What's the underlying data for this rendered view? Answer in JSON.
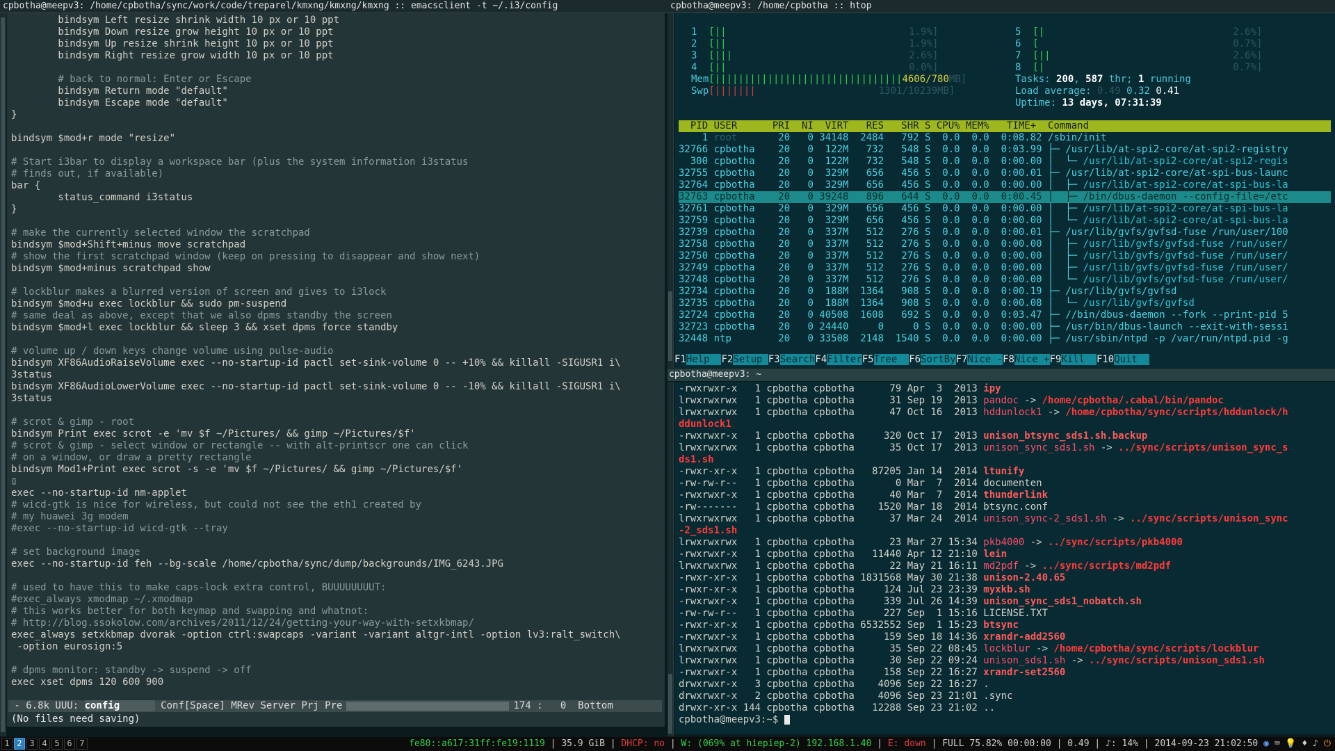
{
  "titles": {
    "emacs": "cpbotha@meepv3: /home/cpbotha/sync/work/code/treparel/kmxng/kmxng/kmxng :: emacsclient -t ~/.i3/config",
    "htop": "cpbotha@meepv3: /home/cpbotha :: htop",
    "terminal": "cpbotha@meepv3: ~"
  },
  "emacs": {
    "lines": [
      {
        "t": "        bindsym Left resize shrink width 10 px or 10 ppt",
        "c": "code"
      },
      {
        "t": "        bindsym Down resize grow height 10 px or 10 ppt",
        "c": "code"
      },
      {
        "t": "        bindsym Up resize shrink height 10 px or 10 ppt",
        "c": "code"
      },
      {
        "t": "        bindsym Right resize grow width 10 px or 10 ppt",
        "c": "code"
      },
      {
        "t": "",
        "c": "code"
      },
      {
        "t": "        # back to normal: Enter or Escape",
        "c": "comment"
      },
      {
        "t": "        bindsym Return mode \"default\"",
        "c": "code"
      },
      {
        "t": "        bindsym Escape mode \"default\"",
        "c": "code"
      },
      {
        "t": "}",
        "c": "code"
      },
      {
        "t": "",
        "c": "code"
      },
      {
        "t": "bindsym $mod+r mode \"resize\"",
        "c": "code"
      },
      {
        "t": "",
        "c": "code"
      },
      {
        "t": "# Start i3bar to display a workspace bar (plus the system information i3status",
        "c": "comment"
      },
      {
        "t": "# finds out, if available)",
        "c": "comment"
      },
      {
        "t": "bar {",
        "c": "code"
      },
      {
        "t": "        status_command i3status",
        "c": "code"
      },
      {
        "t": "}",
        "c": "code"
      },
      {
        "t": "",
        "c": "code"
      },
      {
        "t": "# make the currently selected window the scratchpad",
        "c": "comment"
      },
      {
        "t": "bindsym $mod+Shift+minus move scratchpad",
        "c": "code"
      },
      {
        "t": "# show the first scratchpad window (keep on pressing to disappear and show next)",
        "c": "comment"
      },
      {
        "t": "bindsym $mod+minus scratchpad show",
        "c": "code"
      },
      {
        "t": "",
        "c": "code"
      },
      {
        "t": "# lockblur makes a blurred version of screen and gives to i3lock",
        "c": "comment"
      },
      {
        "t": "bindsym $mod+u exec lockblur && sudo pm-suspend",
        "c": "code"
      },
      {
        "t": "# same deal as above, except that we also dpms standby the screen",
        "c": "comment"
      },
      {
        "t": "bindsym $mod+l exec lockblur && sleep 3 && xset dpms force standby",
        "c": "code"
      },
      {
        "t": "",
        "c": "code"
      },
      {
        "t": "# volume up / down keys change volume using pulse-audio",
        "c": "comment"
      },
      {
        "t": "bindsym XF86AudioRaiseVolume exec --no-startup-id pactl set-sink-volume 0 -- +10% && killall -SIGUSR1 i\\",
        "c": "code"
      },
      {
        "t": "3status",
        "c": "code"
      },
      {
        "t": "bindsym XF86AudioLowerVolume exec --no-startup-id pactl set-sink-volume 0 -- -10% && killall -SIGUSR1 i\\",
        "c": "code"
      },
      {
        "t": "3status",
        "c": "code"
      },
      {
        "t": "",
        "c": "code"
      },
      {
        "t": "# scrot & gimp - root",
        "c": "comment"
      },
      {
        "t": "bindsym Print exec scrot -e 'mv $f ~/Pictures/ && gimp ~/Pictures/$f'",
        "c": "code"
      },
      {
        "t": "# scrot & gimp - select window or rectangle -- with alt-printscr one can click",
        "c": "comment"
      },
      {
        "t": "# on a window, or draw a pretty rectangle",
        "c": "comment"
      },
      {
        "t": "bindsym Mod1+Print exec scrot -s -e 'mv $f ~/Pictures/ && gimp ~/Pictures/$f'",
        "c": "code"
      },
      {
        "t": "▯",
        "c": "code"
      },
      {
        "t": "exec --no-startup-id nm-applet",
        "c": "code"
      },
      {
        "t": "# wicd-gtk is nice for wireless, but could not see the eth1 created by",
        "c": "comment"
      },
      {
        "t": "# my huawei 3g modem",
        "c": "comment"
      },
      {
        "t": "#exec --no-startup-id wicd-gtk --tray",
        "c": "comment"
      },
      {
        "t": "",
        "c": "code"
      },
      {
        "t": "# set background image",
        "c": "comment"
      },
      {
        "t": "exec --no-startup-id feh --bg-scale /home/cpbotha/sync/dump/backgrounds/IMG_6243.JPG",
        "c": "code"
      },
      {
        "t": "",
        "c": "code"
      },
      {
        "t": "# used to have this to make caps-lock extra control, BUUUUUUUUT:",
        "c": "comment"
      },
      {
        "t": "#exec_always xmodmap ~/.xmodmap",
        "c": "comment"
      },
      {
        "t": "# this works better for both keymap and swapping and whatnot:",
        "c": "comment"
      },
      {
        "t": "# http://blog.ssokolow.com/archives/2011/12/24/getting-your-way-with-setxkbmap/",
        "c": "comment"
      },
      {
        "t": "exec_always setxkbmap dvorak -option ctrl:swapcaps -variant -variant altgr-intl -option lv3:ralt_switch\\",
        "c": "code"
      },
      {
        "t": " -option eurosign:5",
        "c": "code"
      },
      {
        "t": "",
        "c": "code"
      },
      {
        "t": "# dpms monitor: standby -> suspend -> off",
        "c": "comment"
      },
      {
        "t": "exec xset dpms 120 600 900",
        "c": "code"
      }
    ],
    "modeline": {
      "left": " - 6.8k UUU: ",
      "buffer": "config      ",
      "modes": " Conf[Space] MRev Server Prj Pre",
      "position": "174 :   0  Bottom"
    },
    "minibuffer": "(No files need saving)"
  },
  "htop": {
    "cpus_left": [
      {
        "n": "1",
        "bar": "[||",
        "pct": "1.9%]"
      },
      {
        "n": "2",
        "bar": "[||",
        "pct": "1.9%]"
      },
      {
        "n": "3",
        "bar": "[|||",
        "pct": "2.6%]"
      },
      {
        "n": "4",
        "bar": "[||",
        "pct": "0.0%]"
      }
    ],
    "cpus_right": [
      {
        "n": "5",
        "bar": "[|",
        "pct": "2.6%]"
      },
      {
        "n": "6",
        "bar": "[",
        "pct": "0.7%]"
      },
      {
        "n": "7",
        "bar": "[||",
        "pct": "2.6%]"
      },
      {
        "n": "8",
        "bar": "[|",
        "pct": "0.7%]"
      }
    ],
    "mem": {
      "label": "Mem",
      "bar": "[||||||||||||||||||||||||||||||||",
      "val": "4606/780",
      "tail": "MB]"
    },
    "swp": {
      "label": "Swp",
      "bar": "[|||||||",
      "val": "",
      "tail": "1301/10239MB]"
    },
    "tasks": {
      "label": "Tasks: ",
      "count": "200",
      "sep": ", ",
      "thr": "587",
      "thr_label": " thr; ",
      "running": "1",
      "running_label": " running"
    },
    "load": {
      "label": "Load average: ",
      "l1": "0.49",
      "l2": "0.32",
      "l3": "0.41"
    },
    "uptime": {
      "label": "Uptime: ",
      "value": "13 days, 07:31:39"
    },
    "header": "  PID USER      PRI  NI  VIRT   RES   SHR S CPU% MEM%   TIME+  Command",
    "rows": [
      {
        "pid": "    1",
        "user": " root    ",
        "rest": "   20   0 34148  2484   792 S  0.0  0.0  0:08.82 ",
        "cmd": "/sbin/init",
        "tree": ""
      },
      {
        "pid": "32766",
        "user": " cpbotha ",
        "rest": "   20   0  122M   732   548 S  0.0  0.0  0:03.99 ",
        "cmd": "/usr/lib/at-spi2-core/at-spi2-registry",
        "tree": "├─ "
      },
      {
        "pid": "  300",
        "user": " cpbotha ",
        "rest": "   20   0  122M   732   548 S  0.0  0.0  0:00.00 ",
        "cmd": "/usr/lib/at-spi2-core/at-spi2-regis",
        "tree": "│  └─ "
      },
      {
        "pid": "32755",
        "user": " cpbotha ",
        "rest": "   20   0  329M   656   456 S  0.0  0.0  0:00.01 ",
        "cmd": "/usr/lib/at-spi2-core/at-spi-bus-launc",
        "tree": "├─ "
      },
      {
        "pid": "32764",
        "user": " cpbotha ",
        "rest": "   20   0  329M   656   456 S  0.0  0.0  0:00.00 ",
        "cmd": "/usr/lib/at-spi2-core/at-spi-bus-la",
        "tree": "│  ├─ "
      },
      {
        "pid": "32763",
        "user": " cpbotha ",
        "rest": "   20   0 39248   896   644 S  0.0  0.0  0:00.45 ",
        "cmd": "/bin/dbus-daemon --config-file=/etc",
        "tree": "│  ├─ ",
        "sel": true
      },
      {
        "pid": "32761",
        "user": " cpbotha ",
        "rest": "   20   0  329M   656   456 S  0.0  0.0  0:00.00 ",
        "cmd": "/usr/lib/at-spi2-core/at-spi-bus-la",
        "tree": "│  ├─ "
      },
      {
        "pid": "32759",
        "user": " cpbotha ",
        "rest": "   20   0  329M   656   456 S  0.0  0.0  0:00.00 ",
        "cmd": "/usr/lib/at-spi2-core/at-spi-bus-la",
        "tree": "│  └─ "
      },
      {
        "pid": "32739",
        "user": " cpbotha ",
        "rest": "   20   0  337M   512   276 S  0.0  0.0  0:00.01 ",
        "cmd": "/usr/lib/gvfs/gvfsd-fuse /run/user/100",
        "tree": "├─ "
      },
      {
        "pid": "32758",
        "user": " cpbotha ",
        "rest": "   20   0  337M   512   276 S  0.0  0.0  0:00.00 ",
        "cmd": "/usr/lib/gvfs/gvfsd-fuse /run/user/",
        "tree": "│  ├─ "
      },
      {
        "pid": "32750",
        "user": " cpbotha ",
        "rest": "   20   0  337M   512   276 S  0.0  0.0  0:00.00 ",
        "cmd": "/usr/lib/gvfs/gvfsd-fuse /run/user/",
        "tree": "│  ├─ "
      },
      {
        "pid": "32749",
        "user": " cpbotha ",
        "rest": "   20   0  337M   512   276 S  0.0  0.0  0:00.00 ",
        "cmd": "/usr/lib/gvfs/gvfsd-fuse /run/user/",
        "tree": "│  ├─ "
      },
      {
        "pid": "32748",
        "user": " cpbotha ",
        "rest": "   20   0  337M   512   276 S  0.0  0.0  0:00.00 ",
        "cmd": "/usr/lib/gvfs/gvfsd-fuse /run/user/",
        "tree": "│  └─ "
      },
      {
        "pid": "32734",
        "user": " cpbotha ",
        "rest": "   20   0  188M  1364   908 S  0.0  0.0  0:00.19 ",
        "cmd": "/usr/lib/gvfs/gvfsd",
        "tree": "├─ "
      },
      {
        "pid": "32735",
        "user": " cpbotha ",
        "rest": "   20   0  188M  1364   908 S  0.0  0.0  0:00.08 ",
        "cmd": "/usr/lib/gvfs/gvfsd",
        "tree": "│  └─ "
      },
      {
        "pid": "32724",
        "user": " cpbotha ",
        "rest": "   20   0 40508  1608   692 S  0.0  0.0  0:03.47 ",
        "cmd": "//bin/dbus-daemon --fork --print-pid 5",
        "tree": "├─ "
      },
      {
        "pid": "32723",
        "user": " cpbotha ",
        "rest": "   20   0 24440     0     0 S  0.0  0.0  0:00.00 ",
        "cmd": "/usr/bin/dbus-launch --exit-with-sessi",
        "tree": "├─ "
      },
      {
        "pid": "32448",
        "user": " ntp     ",
        "rest": "   20   0 33508  2148  1540 S  0.0  0.0  0:00.00 ",
        "cmd": "/usr/sbin/ntpd -p /var/run/ntpd.pid -g",
        "tree": "├─ "
      }
    ],
    "footer": [
      {
        "k": "F1",
        "l": "Help  "
      },
      {
        "k": "F2",
        "l": "Setup "
      },
      {
        "k": "F3",
        "l": "Search"
      },
      {
        "k": "F4",
        "l": "Filter"
      },
      {
        "k": "F5",
        "l": "Tree  "
      },
      {
        "k": "F6",
        "l": "SortBy"
      },
      {
        "k": "F7",
        "l": "Nice -"
      },
      {
        "k": "F8",
        "l": "Nice +"
      },
      {
        "k": "F9",
        "l": "Kill  "
      },
      {
        "k": "F10",
        "l": "Quit  "
      }
    ]
  },
  "terminal": {
    "lines": [
      {
        "p": "-rwxrwxr-x   1 cpbotha cpbotha      79 Apr  3  2013 ",
        "n": "ipy",
        "k": "exe"
      },
      {
        "p": "lrwxrwxrwx   1 cpbotha cpbotha      31 Sep 19  2013 ",
        "n": "pandoc",
        "k": "lnk",
        "a": " -> ",
        "t": "/home/cpbotha/.cabal/bin/pandoc"
      },
      {
        "p": "lrwxrwxrwx   1 cpbotha cpbotha      47 Oct 16  2013 ",
        "n": "hddunlock1",
        "k": "lnk",
        "a": " -> ",
        "t": "/home/cpbotha/sync/scripts/hddunlock/h"
      },
      {
        "p": "",
        "n": "",
        "k": "tgt",
        "t": "ddunlock1"
      },
      {
        "p": "-rwxrwxr-x   1 cpbotha cpbotha     320 Oct 17  2013 ",
        "n": "unison_btsync_sds1.sh.backup",
        "k": "exe"
      },
      {
        "p": "lrwxrwxrwx   1 cpbotha cpbotha      35 Oct 17  2013 ",
        "n": "unison_sync_sds1.sh",
        "k": "lnk",
        "a": " -> ",
        "t": "../sync/scripts/unison_sync_s"
      },
      {
        "p": "",
        "n": "",
        "k": "tgt",
        "t": "ds1.sh"
      },
      {
        "p": "-rwxr-xr-x   1 cpbotha cpbotha   87205 Jan 14  2014 ",
        "n": "ltunify",
        "k": "exe"
      },
      {
        "p": "-rw-rw-r--   1 cpbotha cpbotha       0 Mar  7  2014 ",
        "n": "documenten",
        "k": "dir"
      },
      {
        "p": "-rwxrwxr-x   1 cpbotha cpbotha      40 Mar  7  2014 ",
        "n": "thunderlink",
        "k": "exe"
      },
      {
        "p": "-rw-------   1 cpbotha cpbotha    1520 Mar 18  2014 ",
        "n": "btsync.conf",
        "k": "dir"
      },
      {
        "p": "lrwxrwxrwx   1 cpbotha cpbotha      37 Mar 24  2014 ",
        "n": "unison_sync-2_sds1.sh",
        "k": "lnk",
        "a": " -> ",
        "t": "../sync/scripts/unison_sync"
      },
      {
        "p": "",
        "n": "",
        "k": "tgt",
        "t": "-2_sds1.sh"
      },
      {
        "p": "lrwxrwxrwx   1 cpbotha cpbotha      23 Mar 27 15:34 ",
        "n": "pkb4000",
        "k": "lnk",
        "a": " -> ",
        "t": "../sync/scripts/pkb4000"
      },
      {
        "p": "-rwxrwxr-x   1 cpbotha cpbotha   11440 Apr 12 21:10 ",
        "n": "lein",
        "k": "exe"
      },
      {
        "p": "lrwxrwxrwx   1 cpbotha cpbotha      22 May 21 16:11 ",
        "n": "md2pdf",
        "k": "lnk",
        "a": " -> ",
        "t": "../sync/scripts/md2pdf"
      },
      {
        "p": "-rwxr-xr-x   1 cpbotha cpbotha 1831568 May 30 21:38 ",
        "n": "unison-2.40.65",
        "k": "exe"
      },
      {
        "p": "-rwxr-xr-x   1 cpbotha cpbotha     124 Jul 23 23:39 ",
        "n": "myxkb.sh",
        "k": "exe"
      },
      {
        "p": "-rwxrwxr-x   1 cpbotha cpbotha     339 Jul 26 14:39 ",
        "n": "unison_sync_sds1_nobatch.sh",
        "k": "exe"
      },
      {
        "p": "-rw-rw-r--   1 cpbotha cpbotha     227 Sep  1 15:16 ",
        "n": "LICENSE.TXT",
        "k": "dir"
      },
      {
        "p": "-rwxr-xr-x   1 cpbotha cpbotha 6532552 Sep  1 15:23 ",
        "n": "btsync",
        "k": "exe"
      },
      {
        "p": "-rwxrwxr-x   1 cpbotha cpbotha     159 Sep 18 14:36 ",
        "n": "xrandr-add2560",
        "k": "exe"
      },
      {
        "p": "lrwxrwxrwx   1 cpbotha cpbotha      35 Sep 22 08:45 ",
        "n": "lockblur",
        "k": "lnk",
        "a": " -> ",
        "t": "/home/cpbotha/sync/scripts/lockblur"
      },
      {
        "p": "lrwxrwxrwx   1 cpbotha cpbotha      30 Sep 22 09:24 ",
        "n": "unison_sds1.sh",
        "k": "lnk",
        "a": " -> ",
        "t": "../sync/scripts/unison_sds1.sh"
      },
      {
        "p": "-rwxrwxr-x   1 cpbotha cpbotha     158 Sep 22 16:27 ",
        "n": "xrandr-set2560",
        "k": "exe"
      },
      {
        "p": "drwxrwxr-x   3 cpbotha cpbotha    4096 Sep 22 16:27 ",
        "n": ".",
        "k": "dir"
      },
      {
        "p": "drwxrwxr-x   2 cpbotha cpbotha    4096 Sep 23 21:01 ",
        "n": ".sync",
        "k": "dir"
      },
      {
        "p": "drwxr-xr-x 144 cpbotha cpbotha   12288 Sep 23 21:02 ",
        "n": "..",
        "k": "dir"
      }
    ],
    "prompt": "cpbotha@meepv3:~$ "
  },
  "statusbar": {
    "workspaces": [
      "1",
      "2",
      "3",
      "4",
      "5",
      "6",
      "7"
    ],
    "active_workspace": "2",
    "ipv6": "fe80::a617:31ff:fe19:1119",
    "disk": "35.9 GiB",
    "dhcp": "DHCP: no",
    "wifi": "W: (069% at hiepiep-2) 192.168.1.40",
    "eth": "E: down",
    "battery": "FULL 75.82% 00:00:00",
    "load": "0.49",
    "volume": "♪: 14%",
    "datetime": "2014-09-23 21:02:50",
    "colors": {
      "green": "#38d64a",
      "red": "#ff3030",
      "active_ws": "#2a7fbe"
    }
  }
}
